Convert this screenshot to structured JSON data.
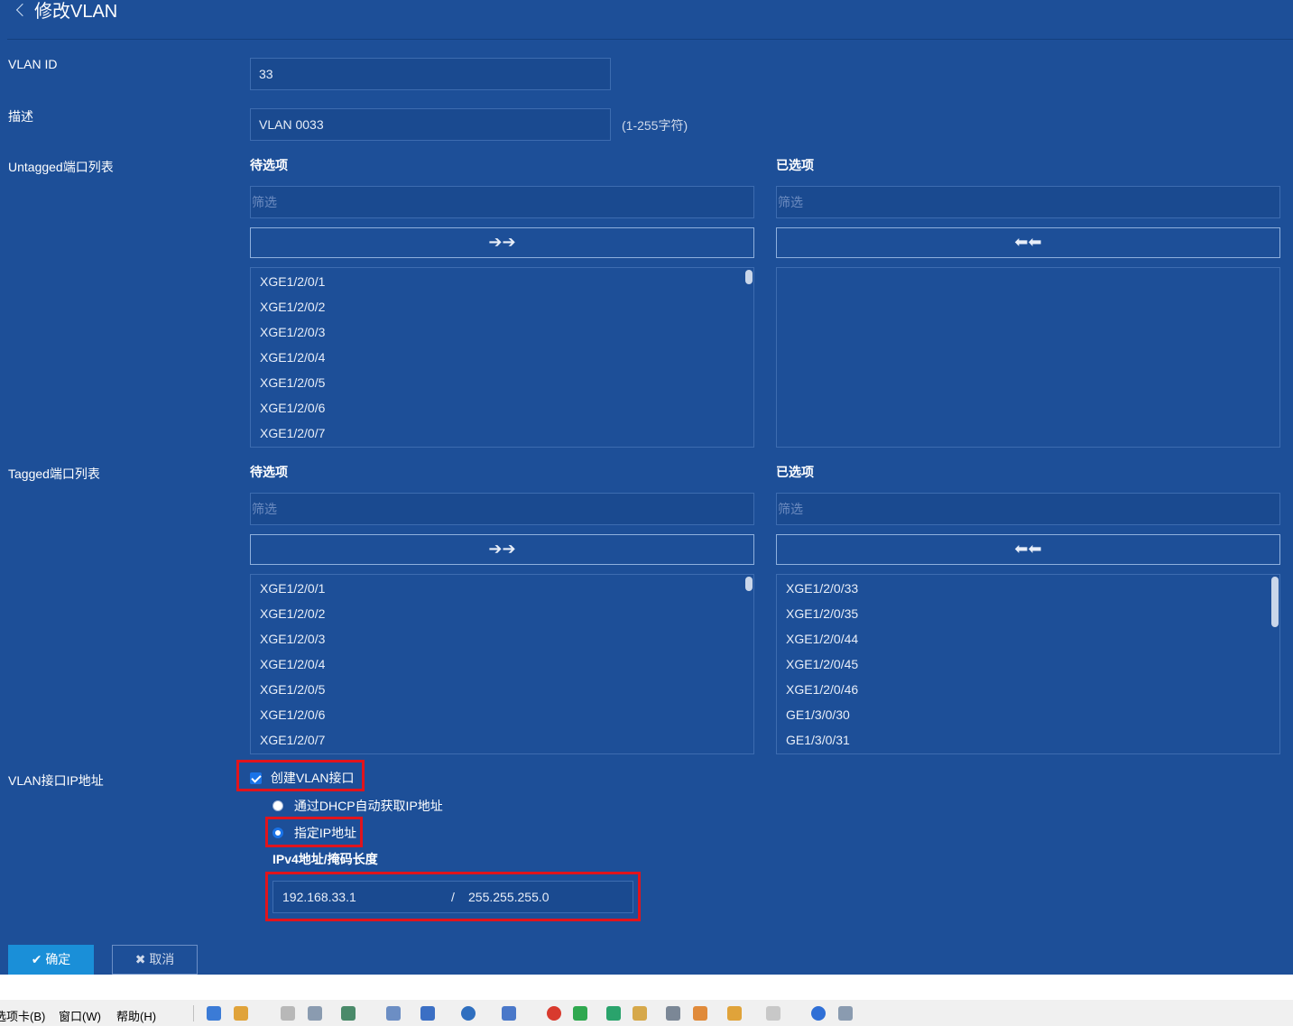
{
  "header": {
    "title": "修改VLAN"
  },
  "form": {
    "vlan_id": {
      "label": "VLAN ID",
      "value": "33"
    },
    "description": {
      "label": "描述",
      "value": "VLAN 0033",
      "hint": "(1-255字符)"
    },
    "untagged": {
      "label": "Untagged端口列表",
      "available_header": "待选项",
      "selected_header": "已选项",
      "filter_placeholder": "筛选",
      "move_right": "➔➔",
      "move_left": "⬅⬅",
      "available": [
        "XGE1/2/0/1",
        "XGE1/2/0/2",
        "XGE1/2/0/3",
        "XGE1/2/0/4",
        "XGE1/2/0/5",
        "XGE1/2/0/6",
        "XGE1/2/0/7"
      ],
      "selected": []
    },
    "tagged": {
      "label": "Tagged端口列表",
      "available_header": "待选项",
      "selected_header": "已选项",
      "filter_placeholder": "筛选",
      "move_right": "➔➔",
      "move_left": "⬅⬅",
      "available": [
        "XGE1/2/0/1",
        "XGE1/2/0/2",
        "XGE1/2/0/3",
        "XGE1/2/0/4",
        "XGE1/2/0/5",
        "XGE1/2/0/6",
        "XGE1/2/0/7"
      ],
      "selected": [
        "XGE1/2/0/33",
        "XGE1/2/0/35",
        "XGE1/2/0/44",
        "XGE1/2/0/45",
        "XGE1/2/0/46",
        "GE1/3/0/30",
        "GE1/3/0/31"
      ]
    },
    "vlan_if": {
      "label": "VLAN接口IP地址",
      "create_checkbox": "创建VLAN接口",
      "create_checked": true,
      "dhcp_option": "通过DHCP自动获取IP地址",
      "static_option": "指定IP地址",
      "selected_option": "static",
      "ipv4_label": "IPv4地址/掩码长度",
      "ip": "192.168.33.1",
      "separator": "/",
      "mask": "255.255.255.0"
    }
  },
  "actions": {
    "ok": "确定",
    "cancel": "取消"
  },
  "taskbar": {
    "menus": [
      "选项卡(B)",
      "窗口(W)",
      "帮助(H)"
    ]
  },
  "colors": {
    "background": "#1d4f98",
    "highlight": "#e1141c",
    "primary_button": "#1a8fd8"
  }
}
